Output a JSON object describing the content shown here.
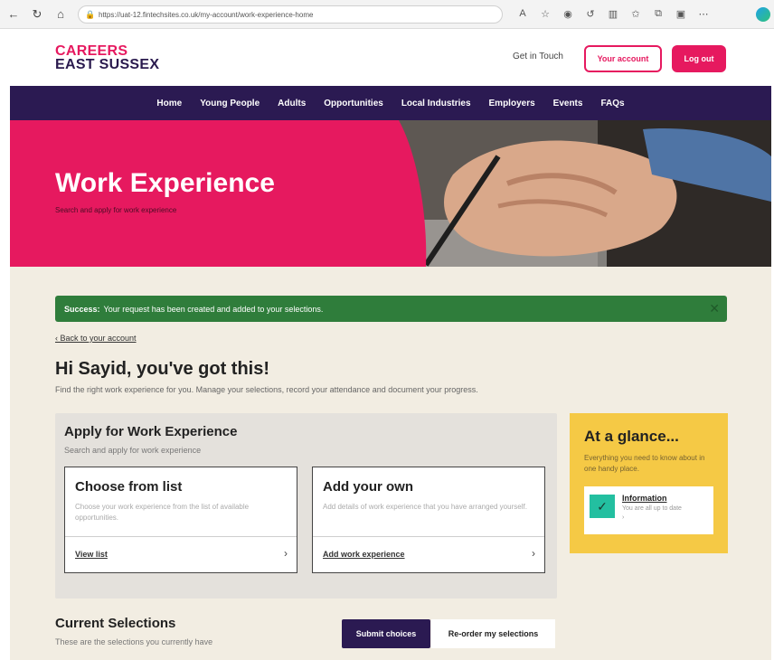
{
  "browser": {
    "url": "https://uat-12.fintechsites.co.uk/my-account/work-experience-home",
    "icons": [
      "back-icon",
      "refresh-icon",
      "lock-icon",
      "read-aloud-icon",
      "favorite-icon",
      "extensions-icon",
      "split-screen-icon",
      "favorites-bar-icon",
      "collections-icon",
      "more-icon",
      "edge-icon"
    ]
  },
  "header": {
    "logo_line1": "CAREERS",
    "logo_line2": "EAST SUSSEX",
    "get_in_touch": "Get in Touch",
    "your_account": "Your account",
    "log_out": "Log out"
  },
  "nav": {
    "items": [
      "Home",
      "Young People",
      "Adults",
      "Opportunities",
      "Local Industries",
      "Employers",
      "Events",
      "FAQs"
    ]
  },
  "hero": {
    "title": "Work Experience",
    "subtitle": "Search and apply for work experience"
  },
  "alert": {
    "strong": "Success:",
    "message": "Your request has been created and added to your selections.",
    "close": "✕"
  },
  "main": {
    "back_link": "Back to your account",
    "greeting": "Hi Sayid, you've got this!",
    "intro": "Find the right work experience for you. Manage your selections, record your attendance and document your progress."
  },
  "apply": {
    "title": "Apply for Work Experience",
    "subtitle": "Search and apply for work experience",
    "cards": [
      {
        "title": "Choose from list",
        "desc": "Choose your work experience from the list of available opportunities.",
        "link": "View list"
      },
      {
        "title": "Add your own",
        "desc": "Add details of work experience that you have arranged yourself.",
        "link": "Add work experience"
      }
    ]
  },
  "glance": {
    "title": "At a glance...",
    "desc": "Everything you need to know about in one handy place.",
    "info_title": "Information",
    "info_sub": "You are all up to date"
  },
  "current": {
    "title": "Current Selections",
    "subtitle": "These are the selections you currently have",
    "submit": "Submit choices",
    "reorder": "Re-order my selections"
  },
  "colors": {
    "brand_pink": "#e6195f",
    "nav_purple": "#2b1a52",
    "success_green": "#2f7d3b",
    "glance_yellow": "#f5c945",
    "check_teal": "#23bfa0",
    "page_bg": "#f2ede2"
  }
}
